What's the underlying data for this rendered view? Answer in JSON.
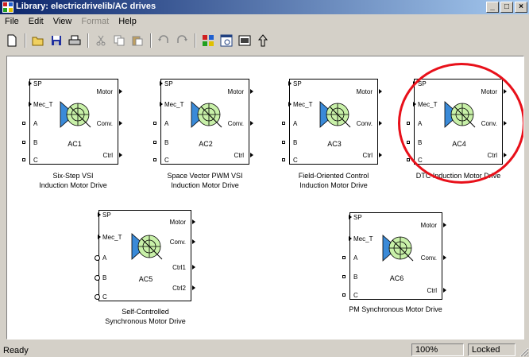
{
  "window": {
    "title": "Library: electricdrivelib/AC drives",
    "min_label": "_",
    "max_label": "□",
    "close_label": "×"
  },
  "menu": {
    "items": [
      {
        "label": "File",
        "enabled": true
      },
      {
        "label": "Edit",
        "enabled": true
      },
      {
        "label": "View",
        "enabled": true
      },
      {
        "label": "Format",
        "enabled": false
      },
      {
        "label": "Help",
        "enabled": true
      }
    ]
  },
  "toolbar": {
    "icons": [
      "new-icon",
      "open-icon",
      "save-icon",
      "print-icon",
      "cut-icon",
      "copy-icon",
      "paste-icon",
      "undo-icon",
      "redo-icon",
      "library-browser-icon",
      "model-explorer-icon",
      "debugger-icon",
      "go-to-parent-icon"
    ]
  },
  "blocks": [
    {
      "id": "AC1",
      "ports_in": [
        "SP",
        "Mec_T",
        "A",
        "B",
        "C"
      ],
      "ports_out": [
        "Motor",
        "Conv.",
        "Ctrl"
      ],
      "caption1": "Six-Step VSI",
      "caption2": "Induction Motor Drive"
    },
    {
      "id": "AC2",
      "ports_in": [
        "SP",
        "Mec_T",
        "A",
        "B",
        "C"
      ],
      "ports_out": [
        "Motor",
        "Conv.",
        "Ctrl"
      ],
      "caption1": "Space Vector PWM VSI",
      "caption2": "Induction Motor Drive"
    },
    {
      "id": "AC3",
      "ports_in": [
        "SP",
        "Mec_T",
        "A",
        "B",
        "C"
      ],
      "ports_out": [
        "Motor",
        "Conv.",
        "Ctrl"
      ],
      "caption1": "Field-Oriented Control",
      "caption2": "Induction Motor Drive"
    },
    {
      "id": "AC4",
      "ports_in": [
        "SP",
        "Mec_T",
        "A",
        "B",
        "C"
      ],
      "ports_out": [
        "Motor",
        "Conv.",
        "Ctrl"
      ],
      "caption1": "DTC Induction Motor Drive",
      "caption2": ""
    },
    {
      "id": "AC5",
      "ports_in": [
        "SP",
        "Mec_T",
        "A",
        "B",
        "C"
      ],
      "ports_out": [
        "Motor",
        "Conv.",
        "Ctrl1",
        "Ctrl2"
      ],
      "caption1": "Self-Controlled",
      "caption2": "Synchronous Motor Drive"
    },
    {
      "id": "AC6",
      "ports_in": [
        "SP",
        "Mec_T",
        "A",
        "B",
        "C"
      ],
      "ports_out": [
        "Motor",
        "Conv.",
        "Ctrl"
      ],
      "caption1": "PM Synchronous Motor Drive",
      "caption2": ""
    }
  ],
  "highlight": {
    "target": "AC4",
    "color": "#e8101a"
  },
  "status": {
    "text": "Ready",
    "zoom": "100%",
    "lock": "Locked"
  },
  "colors": {
    "title_start": "#0a246a",
    "title_end": "#a6caf0",
    "motor_fill": "#c8f0a8",
    "motor_blue": "#3a8ad8"
  }
}
